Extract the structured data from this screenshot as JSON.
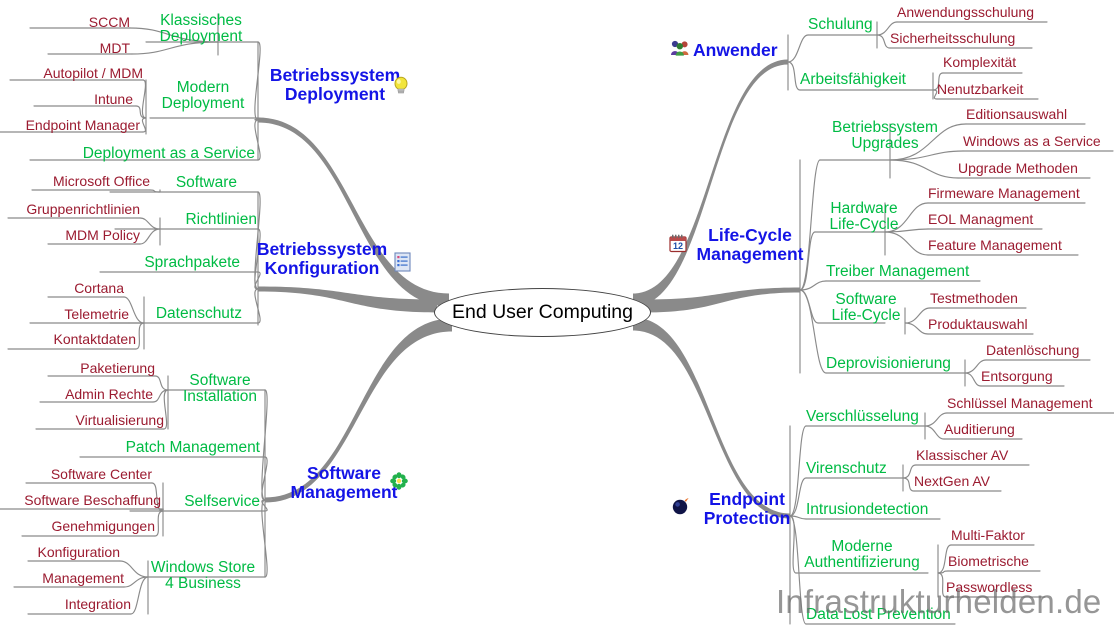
{
  "root": {
    "label": "End User Computing"
  },
  "watermark": {
    "text": "Infrastrukturhelden.de"
  },
  "colors": {
    "root_text": "#000000",
    "level1": "#1414e6",
    "level2": "#00bb44",
    "level3": "#9b1b30",
    "connector": "#808080",
    "main_connector": "#8a8a8a",
    "watermark": "#6e6e6e",
    "background": "#ffffff"
  },
  "branches": {
    "os_deployment": {
      "label_line1": "Betriebssystem",
      "label_line2": "Deployment",
      "icon": "lightbulb-icon",
      "children": {
        "klassisches_deployment": {
          "label_line1": "Klassisches",
          "label_line2": "Deployment",
          "leaves": [
            "SCCM",
            "MDT"
          ]
        },
        "modern_deployment": {
          "label_line1": "Modern",
          "label_line2": "Deployment",
          "leaves": [
            "Autopilot / MDM",
            "Intune",
            "Endpoint Manager"
          ]
        },
        "deployment_as_a_service": {
          "label": "Deployment as a Service",
          "leaves": []
        }
      }
    },
    "os_konfiguration": {
      "label_line1": "Betriebssystem",
      "label_line2": "Konfiguration",
      "icon": "list-document-icon",
      "children": {
        "software": {
          "label": "Software",
          "leaves": [
            "Microsoft Office"
          ]
        },
        "richtlinien": {
          "label": "Richtlinien",
          "leaves": [
            "Gruppenrichtlinien",
            "MDM Policy"
          ]
        },
        "sprachpakete": {
          "label": "Sprachpakete",
          "leaves": []
        },
        "datenschutz": {
          "label": "Datenschutz",
          "leaves": [
            "Cortana",
            "Telemetrie",
            "Kontaktdaten"
          ]
        }
      }
    },
    "software_management": {
      "label_line1": "Software",
      "label_line2": "Management",
      "icon": "green-flower-icon",
      "children": {
        "software_installation": {
          "label_line1": "Software",
          "label_line2": "Installation",
          "leaves": [
            "Paketierung",
            "Admin Rechte",
            "Virtualisierung"
          ]
        },
        "patch_management": {
          "label": "Patch Management",
          "leaves": []
        },
        "selfservice": {
          "label": "Selfservice",
          "leaves": [
            "Software Center",
            "Software Beschaffung",
            "Genehmigungen"
          ]
        },
        "windows_store_4_business": {
          "label_line1": "Windows Store",
          "label_line2": "4 Business",
          "leaves": [
            "Konfiguration",
            "Management",
            "Integration"
          ]
        }
      }
    },
    "anwender": {
      "label": "Anwender",
      "icon": "users-group-icon",
      "children": {
        "schulung": {
          "label": "Schulung",
          "leaves": [
            "Anwendungsschulung",
            "Sicherheitsschulung"
          ]
        },
        "arbeitsfaehigkeit": {
          "label": "Arbeitsfähigkeit",
          "leaves": [
            "Komplexität",
            "Nenutzbarkeit"
          ]
        }
      }
    },
    "life_cycle_management": {
      "label_line1": "Life-Cycle",
      "label_line2": "Management",
      "icon": "calendar-icon",
      "children": {
        "betriebssystem_upgrades": {
          "label_line1": "Betriebssystem",
          "label_line2": "Upgrades",
          "leaves": [
            "Editionsauswahl",
            "Windows as a Service",
            "Upgrade Methoden"
          ]
        },
        "hardware_life_cycle": {
          "label_line1": "Hardware",
          "label_line2": "Life-Cycle",
          "leaves": [
            "Firmeware Management",
            "EOL Managment",
            "Feature Management"
          ]
        },
        "treiber_management": {
          "label": "Treiber Management",
          "leaves": []
        },
        "software_life_cycle": {
          "label_line1": "Software",
          "label_line2": "Life-Cycle",
          "leaves": [
            "Testmethoden",
            "Produktauswahl"
          ]
        },
        "deprovisionierung": {
          "label": "Deprovisionierung",
          "leaves": [
            "Datenlöschung",
            "Entsorgung"
          ]
        }
      }
    },
    "endpoint_protection": {
      "label_line1": "Endpoint",
      "label_line2": "Protection",
      "icon": "dark-sphere-icon",
      "children": {
        "verschluesselung": {
          "label": "Verschlüsselung",
          "leaves": [
            "Schlüssel Management",
            "Auditierung"
          ]
        },
        "virenschutz": {
          "label": "Virenschutz",
          "leaves": [
            "Klassischer AV",
            "NextGen AV"
          ]
        },
        "intrusiondetection": {
          "label": "Intrusiondetection",
          "leaves": []
        },
        "moderne_authentifizierung": {
          "label_line1": "Moderne",
          "label_line2": "Authentifizierung",
          "leaves": [
            "Multi-Faktor",
            "Biometrische",
            "Passwordless"
          ]
        },
        "data_lost_prevention": {
          "label": "Data Lost Prevention",
          "leaves": []
        }
      }
    }
  }
}
